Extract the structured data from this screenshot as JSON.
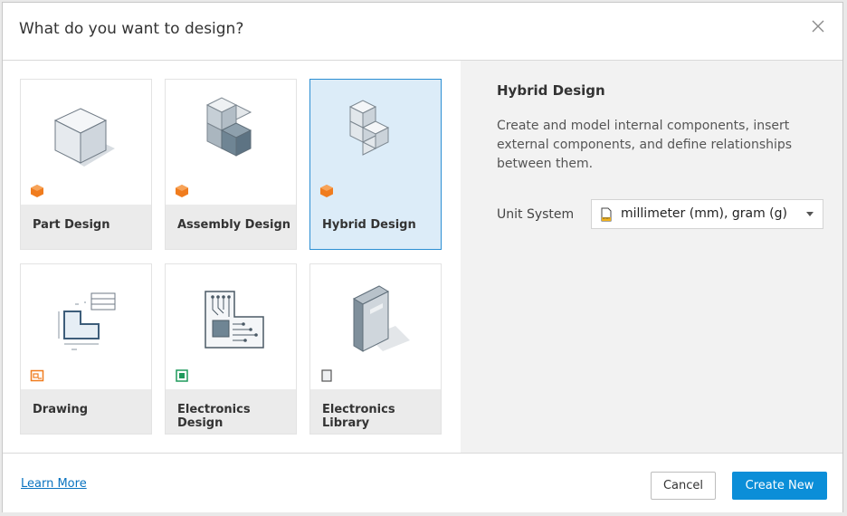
{
  "dialog": {
    "title": "What do you want to design?",
    "close_icon": "close-icon"
  },
  "tiles": [
    {
      "label": "Part Design",
      "icon": "part-cube-icon",
      "badge": "orange-cube-badge",
      "selected": false
    },
    {
      "label": "Assembly Design",
      "icon": "assembly-cubes-icon",
      "badge": "orange-cube-badge",
      "selected": false
    },
    {
      "label": "Hybrid Design",
      "icon": "hybrid-cubes-icon",
      "badge": "orange-cube-badge",
      "selected": true
    },
    {
      "label": "Drawing",
      "icon": "drawing-icon",
      "badge": "drawing-badge",
      "selected": false
    },
    {
      "label": "Electronics Design",
      "icon": "electronics-board-icon",
      "badge": "electronics-badge",
      "selected": false
    },
    {
      "label": "Electronics Library",
      "icon": "library-book-icon",
      "badge": "book-badge",
      "selected": false
    }
  ],
  "details": {
    "title": "Hybrid Design",
    "description": "Create and model internal components, insert external components, and define relationships between them.",
    "unit_label": "Unit System",
    "unit_value": "millimeter (mm), gram (g)"
  },
  "footer": {
    "learn_more": "Learn More",
    "cancel": "Cancel",
    "create": "Create New"
  },
  "colors": {
    "accent": "#0b8ed8",
    "selected_bg": "#dcecf8",
    "selected_border": "#2c8fd3",
    "badge_orange": "#f07c1e"
  }
}
